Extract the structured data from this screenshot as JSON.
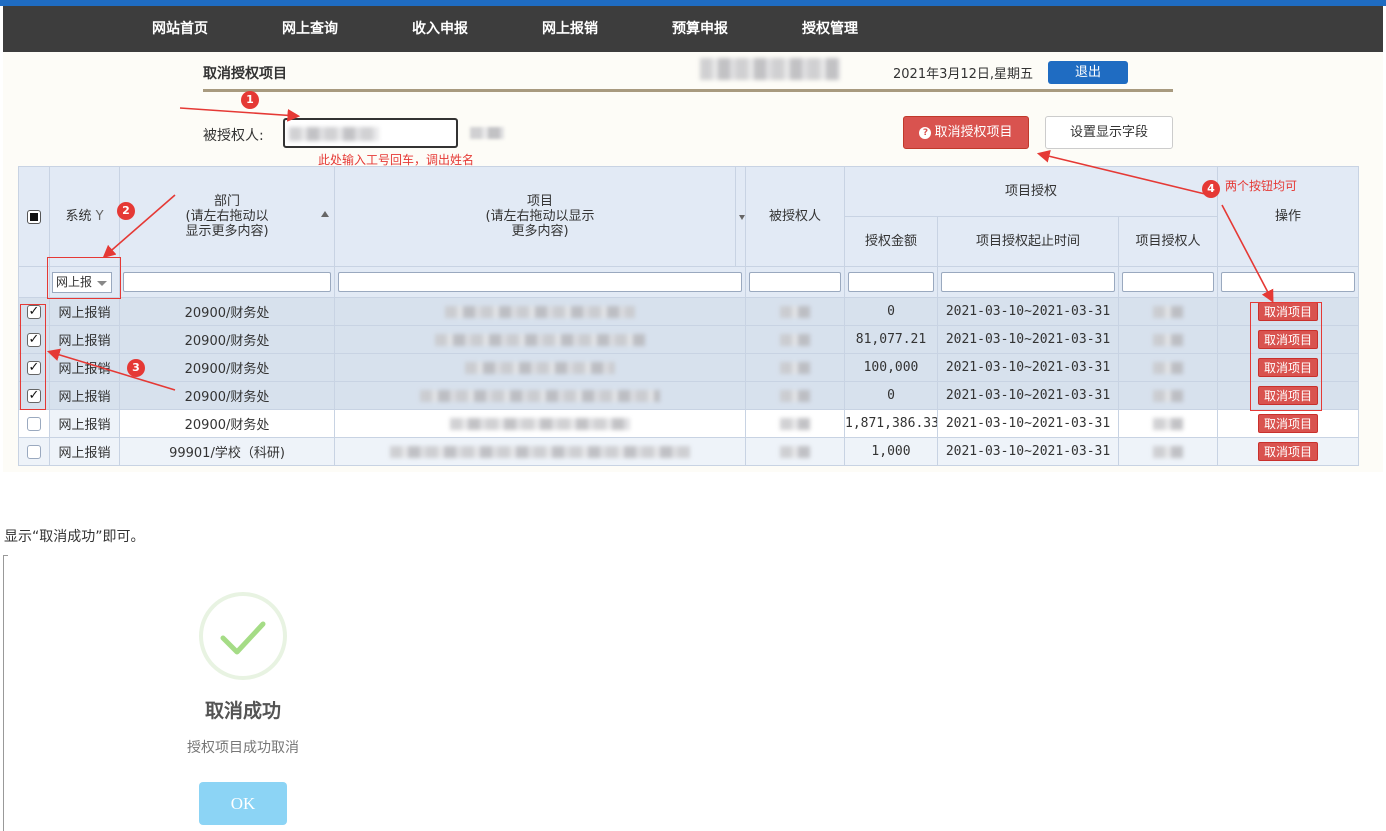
{
  "nav": {
    "items": [
      {
        "label": "网站首页"
      },
      {
        "label": "网上查询"
      },
      {
        "label": "收入申报"
      },
      {
        "label": "网上报销"
      },
      {
        "label": "预算申报"
      },
      {
        "label": "授权管理"
      }
    ]
  },
  "header": {
    "page_title": "取消授权项目",
    "date": "2021年3月12日,星期五",
    "logout_label": "退出"
  },
  "form": {
    "grantee_label": "被授权人:",
    "hint": "此处输入工号回车，调出姓名"
  },
  "toolbar": {
    "cancel_label": "取消授权项目",
    "fields_label": "设置显示字段"
  },
  "table": {
    "headers": {
      "system": "系统",
      "dept_line1": "部门",
      "dept_line2": "(请左右拖动以",
      "dept_line3": "显示更多内容)",
      "project_line1": "项目",
      "project_line2": "(请左右拖动以显示",
      "project_line3": "更多内容)",
      "grantee": "被授权人",
      "project_grant": "项目授权",
      "amount": "授权金额",
      "period": "项目授权起止时间",
      "grantor": "项目授权人",
      "ops": "操作"
    },
    "system_filter_value": "网上报",
    "row_button_label": "取消项目",
    "rows": [
      {
        "checked": "✓",
        "system": "网上报销",
        "dept": "20900/财务处",
        "amount": "0",
        "period": "2021-03-10~2021-03-31"
      },
      {
        "checked": "✓",
        "system": "网上报销",
        "dept": "20900/财务处",
        "amount": "81,077.21",
        "period": "2021-03-10~2021-03-31"
      },
      {
        "checked": "✓",
        "system": "网上报销",
        "dept": "20900/财务处",
        "amount": "100,000",
        "period": "2021-03-10~2021-03-31"
      },
      {
        "checked": "✓",
        "system": "网上报销",
        "dept": "20900/财务处",
        "amount": "0",
        "period": "2021-03-10~2021-03-31"
      },
      {
        "checked": "",
        "system": "网上报销",
        "dept": "20900/财务处",
        "amount": "1,871,386.33",
        "period": "2021-03-10~2021-03-31"
      },
      {
        "checked": "",
        "system": "网上报销",
        "dept": "99901/学校（科研)",
        "amount": "1,000",
        "period": "2021-03-10~2021-03-31"
      }
    ]
  },
  "annotations": {
    "n1": "1",
    "n2": "2",
    "n3": "3",
    "n4": "4",
    "n4_text": "两个按钮均可"
  },
  "caption": "显示“取消成功”即可。",
  "dialog": {
    "title": "取消成功",
    "subtitle": "授权项目成功取消",
    "ok_label": "OK"
  },
  "colors": {
    "nav_bg": "#3d3d3d",
    "accent_blue": "#1f6cc2",
    "danger_red": "#d9534f",
    "annotation_red": "#e53935",
    "success_green": "#a5dc86",
    "ok_button": "#8cd4f5"
  }
}
